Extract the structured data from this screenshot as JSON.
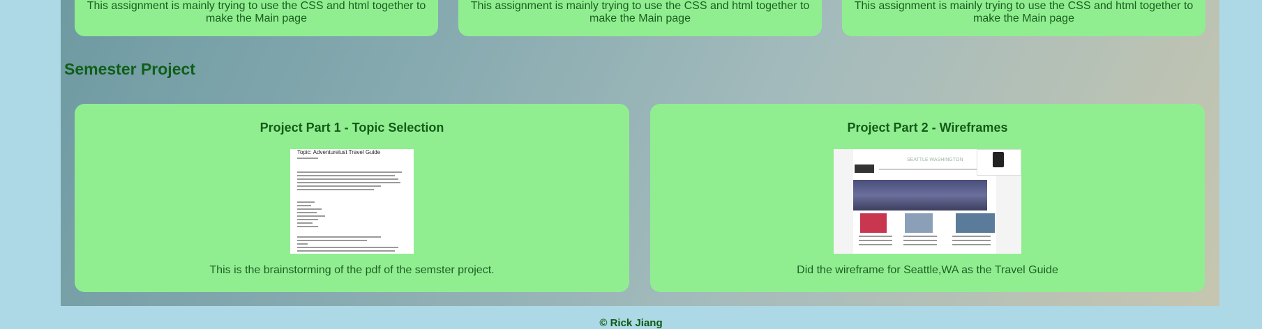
{
  "assignments": [
    {
      "text_line1": "This assignment is mainly trying to use the CSS and html together to",
      "text_line2": "make the Main page"
    },
    {
      "text_line1": "This assignment is mainly trying to use the CSS and html together to",
      "text_line2": "make the Main page"
    },
    {
      "text_line1": "This assignment is mainly trying to use the CSS and html together to",
      "text_line2": "make the Main page"
    }
  ],
  "semester": {
    "title": "Semester Project",
    "projects": [
      {
        "title": "Project Part 1 - Topic Selection",
        "description": "This is the brainstorming of the pdf of the semster project.",
        "image_alt": "Topic selection document preview",
        "doc_title": "Topic: Adventurelust Travel Guide"
      },
      {
        "title": "Project Part 2 - Wireframes",
        "description": "Did the wireframe for Seattle,WA as the Travel Guide",
        "image_alt": "Seattle wireframe preview",
        "doc_title": "SEATTLE WASHINGTON"
      }
    ]
  },
  "footer": {
    "text": "© Rick Jiang"
  },
  "colors": {
    "card_bg": "#90ee90",
    "page_bg": "#add8e6",
    "heading": "#0f5f18"
  }
}
